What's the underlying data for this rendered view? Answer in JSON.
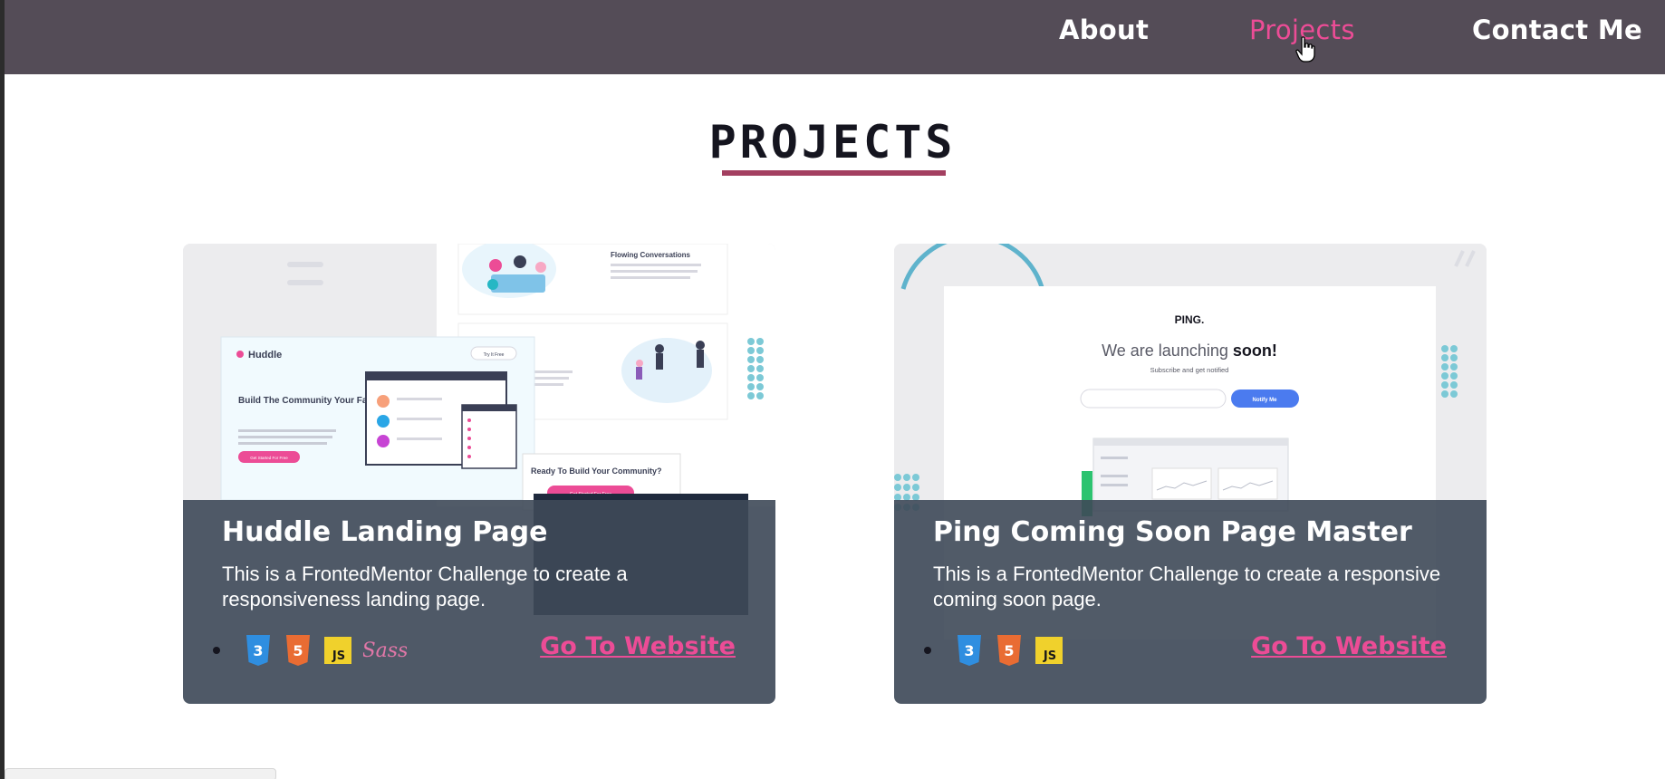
{
  "nav": {
    "about": "About",
    "projects": "Projects",
    "contact": "Contact Me"
  },
  "section": {
    "title": "PROJECTS"
  },
  "projects": [
    {
      "title": "Huddle Landing Page",
      "description": "This is a FrontedMentor Challenge to create a responsiveness landing page.",
      "link": "Go To Website",
      "tech": [
        "css3-icon",
        "html5-icon",
        "js-icon",
        "sass-icon"
      ],
      "preview": {
        "brand": "Huddle",
        "hero_heading": "Build The Community Your Fans Will Love",
        "hero_cta": "Get Started For Free",
        "nav_cta": "Try It Free",
        "feature_heading": "Flowing Conversations",
        "footer_heading": "Ready To Build Your Community?",
        "footer_cta": "Get Started For Free"
      }
    },
    {
      "title": "Ping Coming Soon Page Master",
      "description": "This is a FrontedMentor Challenge to create a responsive coming soon page.",
      "link": "Go To Website",
      "tech": [
        "css3-icon",
        "html5-icon",
        "js-icon"
      ],
      "preview": {
        "brand": "PING.",
        "heading_light": "We are launching ",
        "heading_bold": "soon!",
        "subheading": "Subscribe and get notified",
        "cta": "Notify Me"
      }
    }
  ],
  "colors": {
    "nav_bg": "#544c57",
    "accent": "#ec4c96",
    "underline": "#a33f60",
    "overlay": "#3e4958"
  }
}
